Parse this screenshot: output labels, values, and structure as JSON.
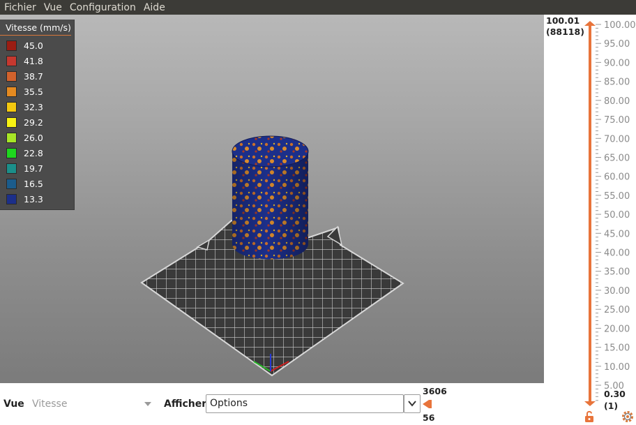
{
  "menu": {
    "items": [
      "Fichier",
      "Vue",
      "Configuration",
      "Aide"
    ]
  },
  "legend": {
    "title": "Vitesse (mm/s)",
    "items": [
      {
        "label": "45.0",
        "color": "#9b1d13"
      },
      {
        "label": "41.8",
        "color": "#c5382f"
      },
      {
        "label": "38.7",
        "color": "#d2622c"
      },
      {
        "label": "35.5",
        "color": "#e48a20"
      },
      {
        "label": "32.3",
        "color": "#f3c80f"
      },
      {
        "label": "29.2",
        "color": "#f7f213"
      },
      {
        "label": "26.0",
        "color": "#a7e626"
      },
      {
        "label": "22.8",
        "color": "#1ed61e"
      },
      {
        "label": "19.7",
        "color": "#1b8f8a"
      },
      {
        "label": "16.5",
        "color": "#1b5c8c"
      },
      {
        "label": "13.3",
        "color": "#1c2f8a"
      }
    ]
  },
  "layer_slider": {
    "top_value": "100.01",
    "top_count": "(88118)",
    "bottom_value": "0.30",
    "bottom_count": "(1)",
    "ticks": [
      "100.00",
      "95.00",
      "90.00",
      "85.00",
      "80.00",
      "75.00",
      "70.00",
      "65.00",
      "60.00",
      "55.00",
      "50.00",
      "45.00",
      "40.00",
      "35.00",
      "30.00",
      "25.00",
      "20.00",
      "15.00",
      "10.00",
      "5.00"
    ],
    "accent_color": "#e8743b",
    "lock_icon": "unlocked-padlock-icon",
    "settings_icon": "gear-icon"
  },
  "bottom": {
    "view_label": "Vue",
    "view_value": "Vitesse",
    "show_label": "Afficher",
    "show_value": "Options",
    "move_slider_top": "3606",
    "move_slider_bottom": "56"
  },
  "scene": {
    "bed_color": "#3a3a3a",
    "grid_line_color": "#d0d0d0",
    "object_color": "#1c2f8a",
    "axis_colors": {
      "x": "#d11f1f",
      "y": "#27b527",
      "z": "#2539d6"
    }
  }
}
